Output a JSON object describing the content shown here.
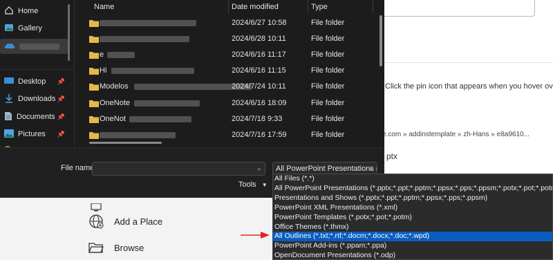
{
  "background": {
    "tip_text": "Click the pin icon that appears when you hover over a file.",
    "path_text": "ce.com » addinstemplate » zh-Hans » e8a9610...",
    "potx_text": "ptx",
    "sidebar": [
      {
        "label": "Add a Place",
        "icon": "globe-icon"
      },
      {
        "label": "Browse",
        "icon": "folder-open-icon"
      }
    ]
  },
  "dialog": {
    "nav": [
      {
        "label": "Home",
        "icon": "home-icon"
      },
      {
        "label": "Gallery",
        "icon": "gallery-icon"
      },
      {
        "label": "",
        "icon": "onedrive-icon"
      },
      {
        "label": "Desktop",
        "icon": "desktop-icon"
      },
      {
        "label": "Downloads",
        "icon": "download-icon"
      },
      {
        "label": "Documents",
        "icon": "documents-icon"
      },
      {
        "label": "Pictures",
        "icon": "pictures-icon"
      }
    ],
    "columns": {
      "name": "Name",
      "date": "Date modified",
      "type": "Type"
    },
    "files": [
      {
        "name": "",
        "date": "2024/6/27 10:58",
        "type": "File folder"
      },
      {
        "name": "",
        "date": "2024/6/28 10:11",
        "type": "File folder"
      },
      {
        "name": "e",
        "date": "2024/6/16 11:17",
        "type": "File folder"
      },
      {
        "name": "Hi",
        "date": "2024/6/16 11:15",
        "type": "File folder"
      },
      {
        "name": "Modelos",
        "date": "2024/7/24 10:11",
        "type": "File folder"
      },
      {
        "name": "OneNote",
        "date": "2024/6/16 18:09",
        "type": "File folder"
      },
      {
        "name": "OneNot",
        "date": "2024/7/18 9:33",
        "type": "File folder"
      },
      {
        "name": "",
        "date": "2024/7/16 17:59",
        "type": "File folder"
      }
    ],
    "file_name_label": "File name:",
    "file_name_value": "",
    "file_type_selected": "All PowerPoint Presentations (*.",
    "tools_label": "Tools"
  },
  "dropdown": {
    "options": [
      "All Files (*.*)",
      "All PowerPoint Presentations (*.pptx;*.ppt;*.pptm;*.ppsx;*.pps;*.ppsm;*.potx;*.pot;*.potm;*.odp)",
      "Presentations and Shows (*.pptx;*.ppt;*.pptm;*.ppsx;*.pps;*.ppsm)",
      "PowerPoint XML Presentations (*.xml)",
      "PowerPoint Templates (*.potx;*.pot;*.potm)",
      "Office Themes (*.thmx)",
      "All Outlines (*.txt;*.rtf;*.docm;*.docx;*.doc;*.wpd)",
      "PowerPoint Add-ins (*.ppam;*.ppa)",
      "OpenDocument Presentations (*.odp)"
    ],
    "selected_index": 6
  },
  "colors": {
    "highlight": "#0a5dbf",
    "arrow": "#e0262b",
    "folder": "#e8b84a"
  }
}
